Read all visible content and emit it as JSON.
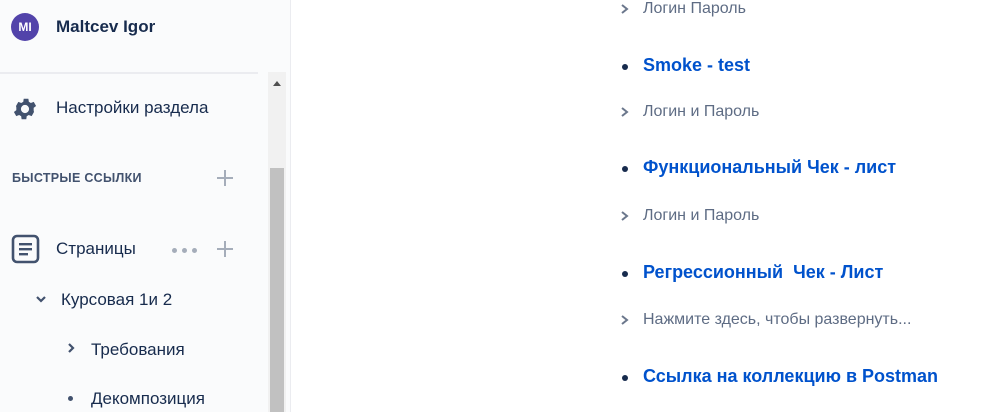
{
  "user": {
    "initials": "MI",
    "name": "Maltcev Igor",
    "avatar_color": "#5243aa"
  },
  "sidebar": {
    "settings_label": "Настройки раздела",
    "quick_links_title": "БЫСТРЫЕ ССЫЛКИ",
    "pages_label": "Страницы",
    "tree": [
      {
        "label": "Курсовая 1и 2",
        "icon": "chevron-down-icon"
      },
      {
        "label": "Требования",
        "icon": "chevron-right-icon"
      },
      {
        "label": "Декомпозиция",
        "icon": "bullet-icon"
      }
    ]
  },
  "content": {
    "expand_top": "Логин Пароль",
    "items": [
      {
        "title": "Smoke - test",
        "expand": "Логин и Пароль"
      },
      {
        "title": "Функциональный Чек - лист",
        "expand": "Логин и Пароль"
      },
      {
        "title": "Регрессионный  Чек - Лист",
        "expand": "Нажмите здесь, чтобы развернуть..."
      },
      {
        "title": "Ссылка на коллекцию в Postman"
      }
    ]
  },
  "colors": {
    "link": "#0052cc",
    "text": "#172b4d",
    "muted": "#5e6c84"
  }
}
